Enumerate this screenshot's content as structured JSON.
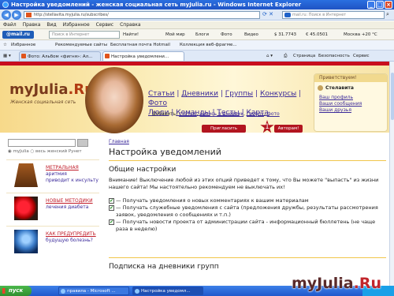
{
  "window": {
    "title": "Настройка уведомлений - женская социальная сеть myJulia.ru - Windows Internet Explorer"
  },
  "address_bar": {
    "url": "http://stellavita.myjulia.ru/subscribes/",
    "search_placeholder": "mail.ru: Поиск в Интернет"
  },
  "menu": [
    "Файл",
    "Правка",
    "Вид",
    "Избранное",
    "Сервис",
    "Справка"
  ],
  "mailru_toolbar": {
    "logo": "@mail.ru",
    "search_placeholder": "Поиск в Интернет",
    "find": "Найти!",
    "items": [
      "Мой мир",
      "Блоги",
      "Фото",
      "Видео"
    ],
    "usd": "$ 31.7743",
    "eur": "€ 45.0501",
    "weather": "Москва +20 °C"
  },
  "favorites_bar": {
    "favorites": "Избранное",
    "items": [
      "Рекомендуемые сайты",
      "Бесплатная почта Hotmail",
      "Коллекция веб-фрагме..."
    ]
  },
  "tabs": [
    {
      "label": "Фото: Альбом «фигня»: Ал..."
    },
    {
      "label": "Настройка уведомлени..."
    }
  ],
  "command_bar": [
    "Страница",
    "Безопасность",
    "Сервис"
  ],
  "site": {
    "logo_main": "myJulia",
    "logo_ru": ".Ru",
    "tagline": "Женская социальная сеть",
    "nav_row1": [
      "Статьи",
      "Дневники",
      "Группы",
      "Конкурсы",
      "Фото"
    ],
    "nav_row2": [
      "Люди",
      "Команды",
      "Тесты",
      "Карта"
    ],
    "add_label": "Добавить:",
    "add_links": [
      "статью",
      "запись в дневник",
      "группу",
      "фото"
    ],
    "invite_button": "Пригласить подруг",
    "star_number": "1",
    "authors_button": "Авторам!",
    "greeting": "Приветствуем!",
    "username": "Стелавита",
    "profile_links": [
      "Ваш профиль",
      "Ваши сообщения",
      "Ваши друзья"
    ],
    "search_scope": [
      "myJulia",
      "весь женский Рунет"
    ],
    "search_go": "",
    "promos": [
      {
        "line1": "МЕТРАЛЬНАЯ",
        "line2": "аритмия",
        "line3": "приводит к инсульту"
      },
      {
        "line1": "НОВЫЕ МЕТОДИКИ",
        "line2": "лечения диабета",
        "line3": ""
      },
      {
        "line1": "КАК ПРЕДУПРЕДИТЬ",
        "line2": "будущую болезнь?",
        "line3": ""
      }
    ]
  },
  "content": {
    "breadcrumb": "Главная",
    "title": "Настройка уведомлений",
    "section1": "Общие настройки",
    "warning": "Внимание! Выключение любой из этих опций приведет к тому, что Вы можете \"выпасть\" из жизни нашего сайта! Мы настоятельно рекомендуем не выключать их!",
    "options": [
      {
        "checked": true,
        "text": "— Получать уведомления о новых комментариях к вашим материалам"
      },
      {
        "checked": true,
        "text": "— Получать служебные уведомления с сайта (предложения дружбы, результаты рассмотрения заявок, уведомления о сообщениях и т.п.)"
      },
      {
        "checked": true,
        "text": "— Получать новости проекта от администрации сайта - информационный бюллетень (не чаще раза в неделю)"
      }
    ],
    "section2": "Подписка на дневники групп"
  },
  "taskbar": {
    "start": "пуск",
    "tasks": [
      "правила - Microsoft ...",
      "Настройка уведомл..."
    ]
  },
  "watermark": {
    "main": "myJulia",
    "ru": ".Ru"
  },
  "colors": {
    "accent_red": "#c80d1e",
    "link": "#3b2a9a",
    "header_gold": "#f7d98a"
  }
}
